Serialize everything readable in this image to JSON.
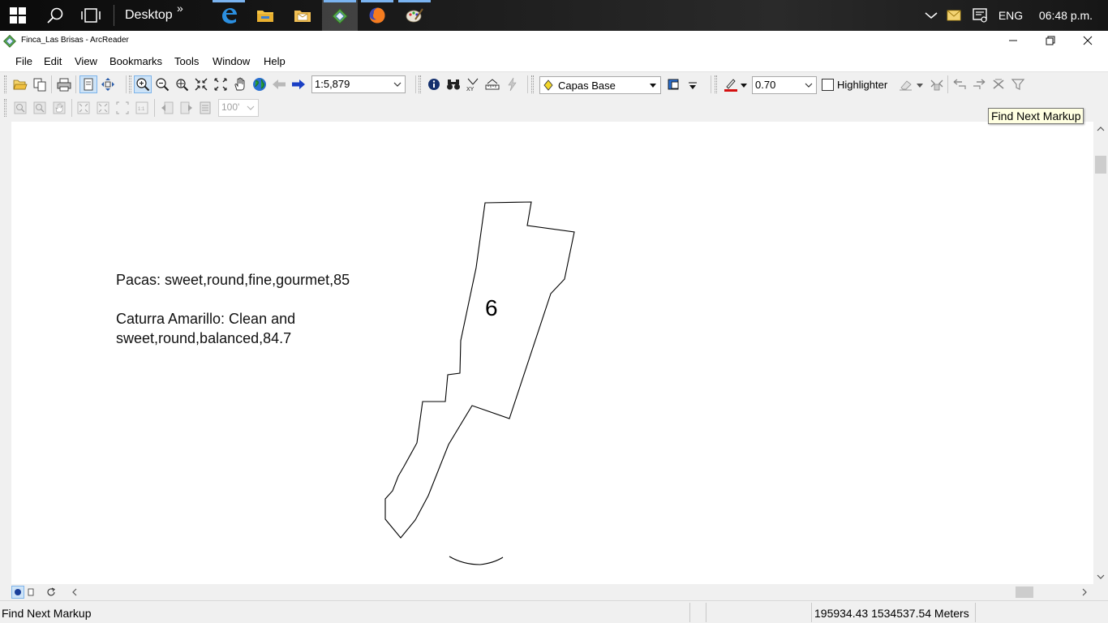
{
  "taskbar": {
    "desktop_label": "Desktop",
    "chevron": "»",
    "language": "ENG",
    "clock": "06:48 p.m.",
    "apps": [
      "edge-icon",
      "file-explorer-icon",
      "mail-folder-icon",
      "arcreader-icon",
      "firefox-icon",
      "paint-icon"
    ]
  },
  "window": {
    "title": "Finca_Las Brisas - ArcReader"
  },
  "menu": {
    "items": [
      "File",
      "Edit",
      "View",
      "Bookmarks",
      "Tools",
      "Window",
      "Help"
    ]
  },
  "toolbar": {
    "scale_value": "1:5,879",
    "layer_value": "Capas Base",
    "transparency_value": "0.70",
    "highlighter_label": "Highlighter",
    "layout_zoom_value": "100'"
  },
  "tooltip": {
    "text": "Find Next Markup"
  },
  "map": {
    "annotation_line1": "Pacas: sweet,round,fine,gourmet,85",
    "annotation_line2": "Caturra Amarillo: Clean and",
    "annotation_line3": "sweet,round,balanced,84.7",
    "parcel_number": "6"
  },
  "status": {
    "message": "Find Next Markup",
    "coordinates": "195934.43  1534537.54 Meters"
  },
  "colors": {
    "taskbar_bg": "#1a1a1a",
    "tooltip_bg": "#ffffe1",
    "pressed_tool": "#cde3f7"
  }
}
